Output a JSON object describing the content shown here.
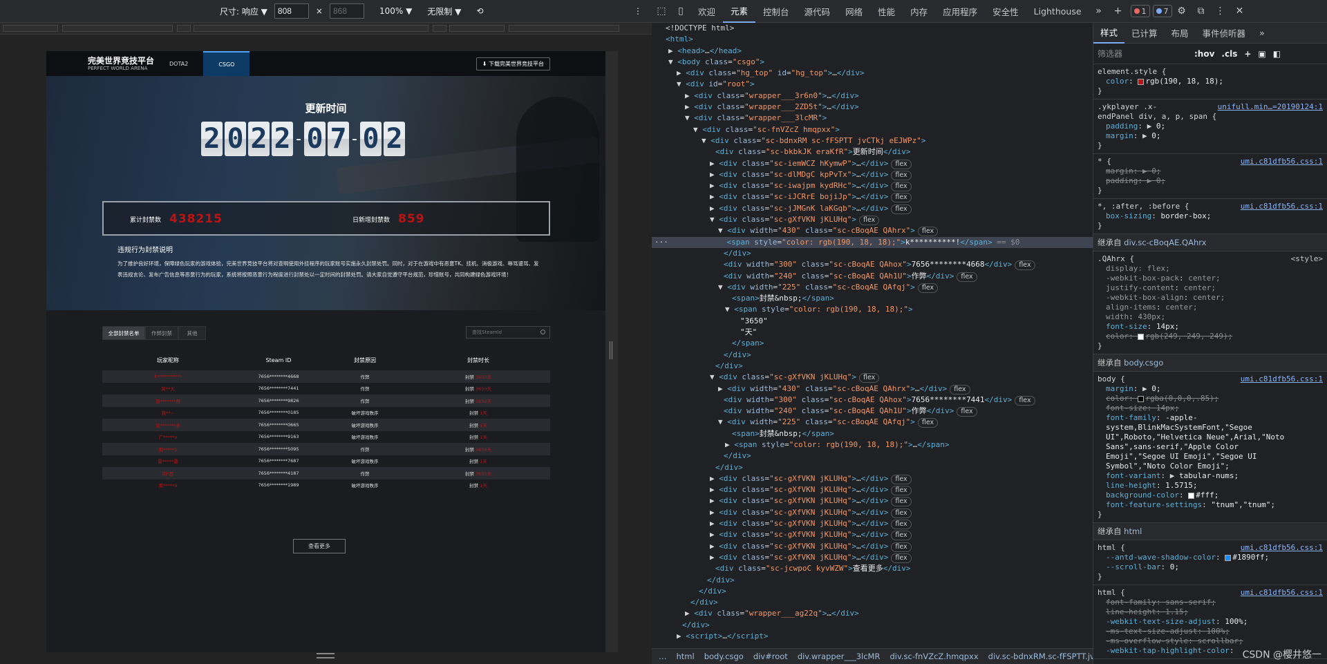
{
  "toolbar": {
    "size_label": "尺寸: 响应 ▼",
    "width": "808",
    "height": "868",
    "x_sep": "×",
    "zoom": "100% ▼",
    "throttle": "无限制 ▼",
    "menu": "⋮"
  },
  "site": {
    "logo_cn": "完美世界竞技平台",
    "logo_en": "PERFECT WORLD ARENA",
    "tabs": [
      "DOTA2",
      "CSGO"
    ],
    "download": "⬇ 下载完美世界竞技平台",
    "update_title": "更新时间",
    "date": [
      "2",
      "0",
      "2",
      "2",
      "-",
      "0",
      "7",
      "-",
      "0",
      "2"
    ],
    "total_label": "累计封禁数",
    "total_value": "438215",
    "today_label": "日新增封禁数",
    "today_value": "859",
    "rules_title": "违规行为封禁说明",
    "rules_text": "为了维护良好环境，保障绿色玩家的游戏体验，完美世界竞技平台将对查明使用外挂程序的玩家账号实施永久封禁处罚。同时，对于在游戏中有恶意TK、挂机、消极游戏、辱骂谩骂、发表违规言论、发布广告信息等恶意行为的玩家，系统将按照恶意行为程度进行封禁处以一定时间的封禁处罚。请大家自觉遵守平台规范，珍惜账号，共同构建绿色游戏环境！",
    "filters": [
      "全部封禁名单",
      "作弊封禁",
      "其他"
    ],
    "search_placeholder": "查找SteamId",
    "headers": [
      "玩家昵称",
      "Steam ID",
      "封禁原因",
      "封禁时长"
    ],
    "rows": [
      [
        "k**********!",
        "7656********4668",
        "作弊",
        "封禁 ",
        "3650天"
      ],
      [
        "哭**大",
        "7656********7441",
        "作弊",
        "封禁 ",
        "3650天"
      ],
      [
        "冒*******用",
        "7656********9826",
        "作弊",
        "封禁 ",
        "3650天"
      ],
      [
        "我**~",
        "7656********0185",
        "破坏游戏秩序",
        "封禁 ",
        "1天"
      ],
      [
        "论*******多",
        "7656********0665",
        "破坏游戏秩序",
        "封禁 ",
        "1天"
      ],
      [
        "广*****o",
        "7656********9163",
        "破坏游戏秩序",
        "封禁 ",
        "1天"
      ],
      [
        "用*****5",
        "7656********5095",
        "作弊",
        "封禁 ",
        "3650天"
      ],
      [
        "雷*****雷",
        "7656********7687",
        "破坏游戏秩序",
        "封禁 ",
        "1天"
      ],
      [
        "四*百",
        "7656********4187",
        "作弊",
        "封禁 ",
        "3650天"
      ],
      [
        "用*****9",
        "7656********1989",
        "破坏游戏秩序",
        "封禁 ",
        "1天"
      ]
    ],
    "more": "查看更多"
  },
  "devtools": {
    "tabs": [
      "欢迎",
      "元素",
      "控制台",
      "源代码",
      "网络",
      "性能",
      "内存",
      "应用程序",
      "安全性",
      "Lighthouse"
    ],
    "errors": "1",
    "messages": "7",
    "breadcrumbs": [
      "html",
      "body.csgo",
      "div#root",
      "div.wrapper___3lcMR",
      "div.sc-fnVZcZ.hmqpxx",
      "div.sc-bdnxRM.sc-fFSPTT.jvCTkj."
    ],
    "style_tabs": [
      "样式",
      "已计算",
      "布局",
      "事件侦听器"
    ],
    "filter_placeholder": "筛选器",
    "hov": ":hov",
    "cls": ".cls",
    "watermark": "CSDN @樱井悠一"
  },
  "colors": {
    "accent": "#be1212",
    "blue": "#1890ff"
  }
}
